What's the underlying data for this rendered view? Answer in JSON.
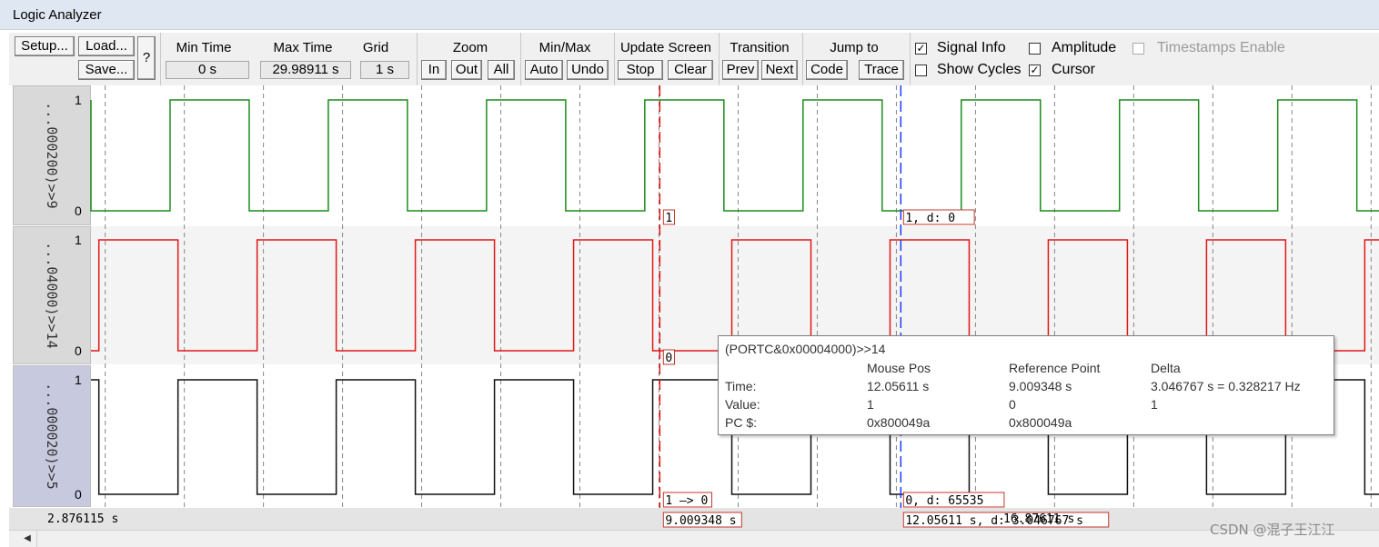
{
  "window": {
    "title": "Logic Analyzer"
  },
  "toolbar": {
    "setup": "Setup...",
    "load": "Load...",
    "save": "Save...",
    "help": "?",
    "min_time": {
      "label": "Min Time",
      "value": "0 s"
    },
    "max_time": {
      "label": "Max Time",
      "value": "29.98911 s"
    },
    "grid": {
      "label": "Grid",
      "value": "1 s"
    },
    "zoom": {
      "label": "Zoom",
      "in": "In",
      "out": "Out",
      "all": "All"
    },
    "minmax": {
      "label": "Min/Max",
      "auto": "Auto",
      "undo": "Undo"
    },
    "update": {
      "label": "Update Screen",
      "stop": "Stop",
      "clear": "Clear"
    },
    "transition": {
      "label": "Transition",
      "prev": "Prev",
      "next": "Next"
    },
    "jump": {
      "label": "Jump to",
      "code": "Code",
      "trace": "Trace"
    },
    "options": {
      "signal_info": {
        "label": "Signal Info",
        "checked": true
      },
      "amplitude": {
        "label": "Amplitude",
        "checked": false
      },
      "timestamps": {
        "label": "Timestamps Enable",
        "checked": false,
        "disabled": true
      },
      "show_cycles": {
        "label": "Show Cycles",
        "checked": false
      },
      "cursor": {
        "label": "Cursor",
        "checked": true
      }
    }
  },
  "signals": [
    {
      "name": "...000200)>>9",
      "high": "1",
      "low": "0",
      "color": "#1c8c1c",
      "start_level": 1,
      "period_s": 2.0,
      "phase_s": 0.0
    },
    {
      "name": "...04000)>>14",
      "high": "1",
      "low": "0",
      "color": "#e01818",
      "start_level": 0,
      "period_s": 2.0,
      "phase_s": 0.1
    },
    {
      "name": "...000020)>>5",
      "high": "1",
      "low": "0",
      "color": "#111111",
      "start_level": 1,
      "period_s": 2.0,
      "phase_s": 0.1
    }
  ],
  "view": {
    "start_s": 1.82,
    "end_s": 18.1
  },
  "markers": {
    "reference_s": 9.009348,
    "cursor_s": 12.05611,
    "sig0_ref_label": "1",
    "sig1_ref_label": "0",
    "sig2_ref_label": "1 —> 0",
    "sig0_cur_label": "1,   d: 0",
    "sig2_cur_label": "0,   d: 65535"
  },
  "timeline": {
    "left": "2.876115 s",
    "reference": "9.009348 s",
    "cursor": "12.05611 s,   d: 3.046767 s",
    "right": "16.87611 s"
  },
  "tooltip": {
    "title": "(PORTC&0x00004000)>>14",
    "headers": {
      "mouse": "Mouse Pos",
      "ref": "Reference Point",
      "delta": "Delta"
    },
    "rows": [
      {
        "label": "Time:",
        "mouse": "12.05611 s",
        "ref": "9.009348 s",
        "delta": "3.046767 s = 0.328217 Hz"
      },
      {
        "label": "Value:",
        "mouse": "1",
        "ref": "0",
        "delta": "1"
      },
      {
        "label": "PC $:",
        "mouse": "0x800049a",
        "ref": "0x800049a",
        "delta": ""
      }
    ]
  },
  "watermark": "CSDN @混子王江江",
  "colors": {
    "reference_marker": "#e01818",
    "cursor_marker": "#1a3cff",
    "grid": "#888888"
  }
}
